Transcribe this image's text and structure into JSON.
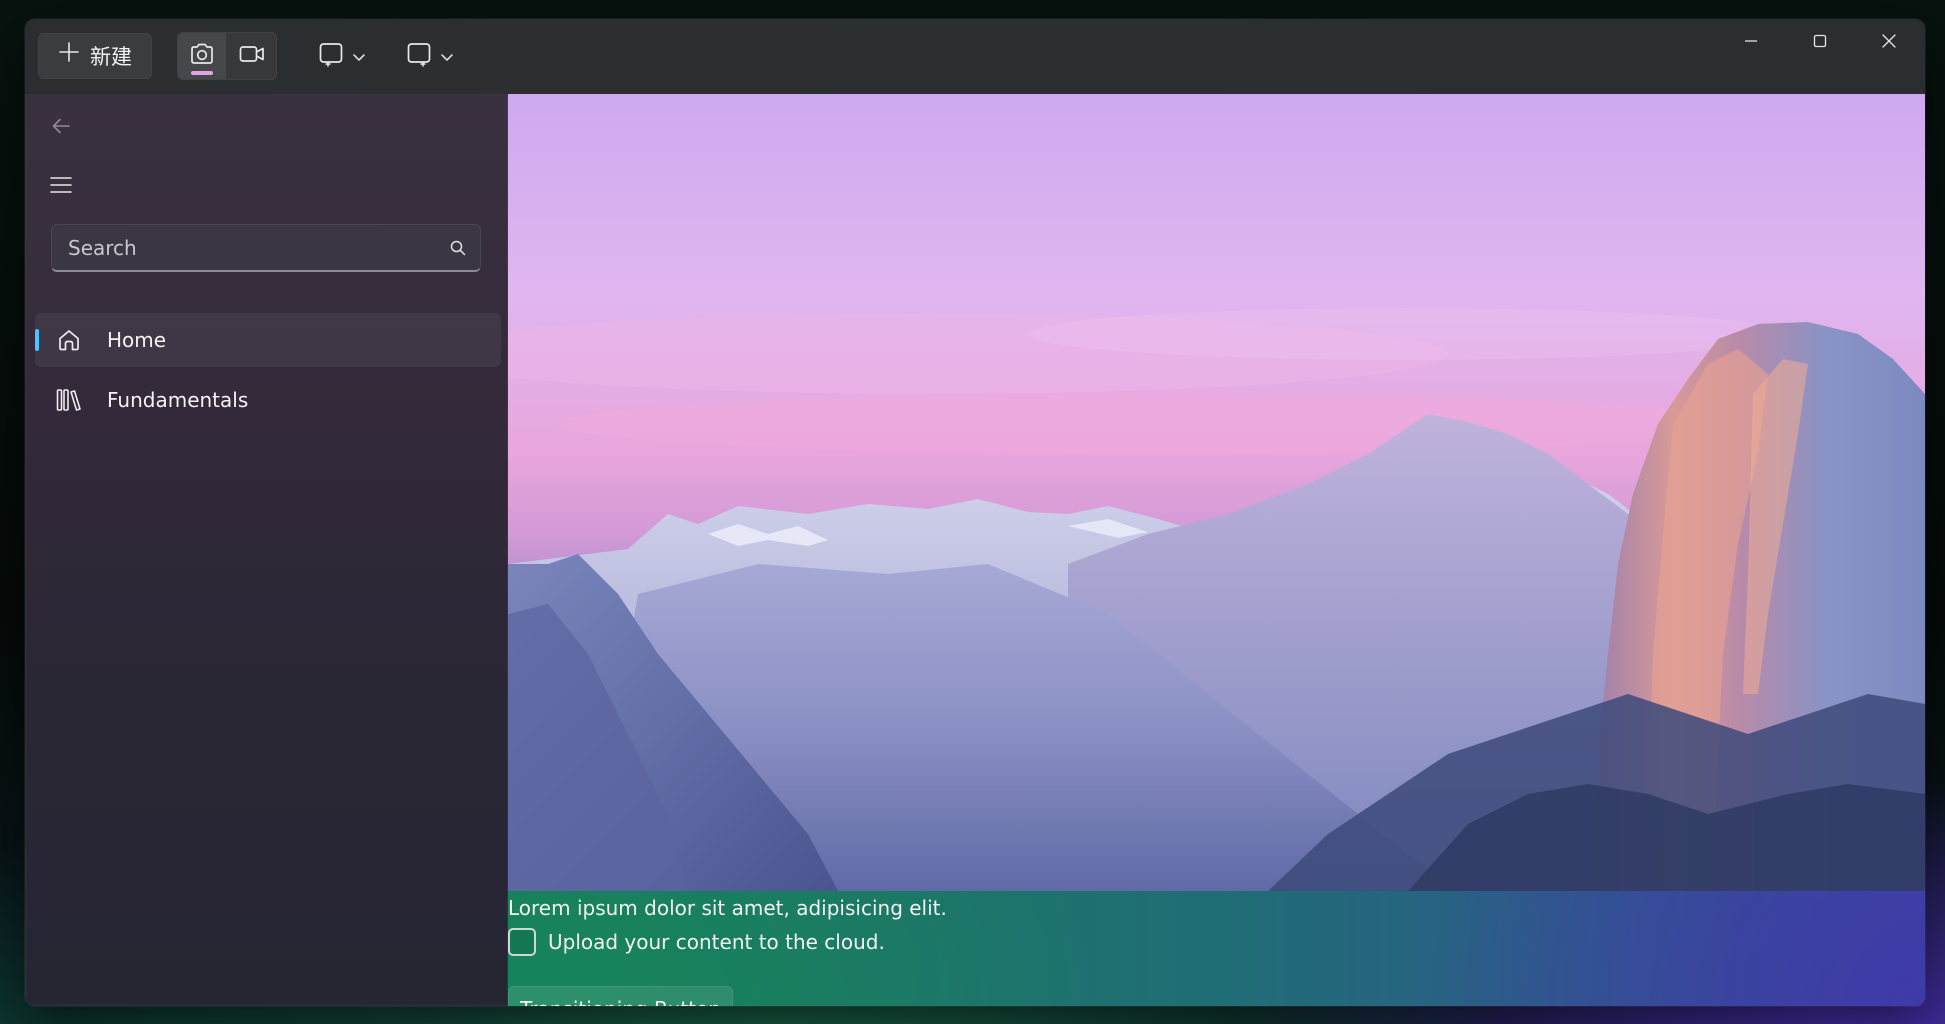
{
  "toolbar": {
    "new_label": "新建",
    "new_icon": "plus-icon",
    "capture_modes": [
      {
        "icon": "camera-icon",
        "selected": true
      },
      {
        "icon": "video-icon",
        "selected": false
      }
    ],
    "accent_color": "#e4a3e4"
  },
  "window_controls": [
    "minimize-icon",
    "maximize-icon",
    "close-icon"
  ],
  "sidebar": {
    "search_placeholder": "Search",
    "items": [
      {
        "label": "Home",
        "icon": "home-icon",
        "selected": true
      },
      {
        "label": "Fundamentals",
        "icon": "library-icon",
        "selected": false
      }
    ],
    "selection_color": "#4cc2ff"
  },
  "main": {
    "caption": "Lorem ipsum dolor sit amet, adipisicing elit.",
    "checkbox_label": "Upload your content to the cloud.",
    "checkbox_checked": false,
    "button_label": "Transitioning Button"
  }
}
